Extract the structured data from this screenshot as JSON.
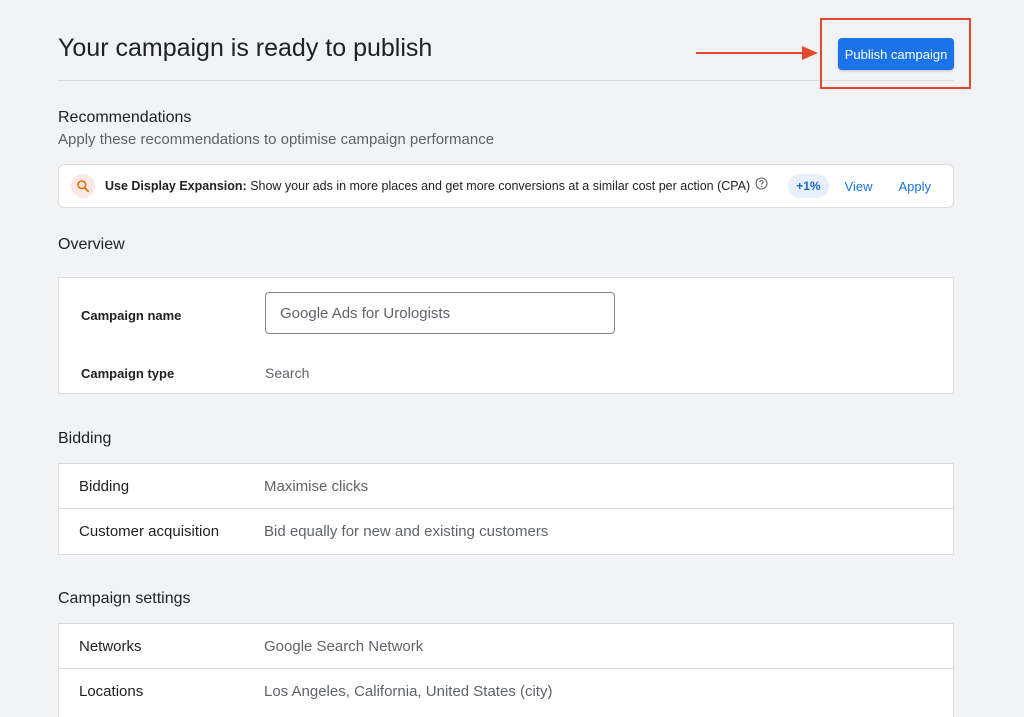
{
  "page": {
    "title": "Your campaign is ready to publish",
    "publish_label": "Publish campaign"
  },
  "recommendations": {
    "heading": "Recommendations",
    "subtitle": "Apply these recommendations to optimise campaign performance",
    "item": {
      "icon": "search-icon",
      "title": "Use Display Expansion:",
      "description": " Show your ads in more places and get more conversions at a similar cost per action (CPA)",
      "uplift": "+1%",
      "view_label": "View",
      "apply_label": "Apply"
    }
  },
  "overview": {
    "heading": "Overview",
    "campaign_name_label": "Campaign name",
    "campaign_name_value": "Google Ads for Urologists",
    "campaign_type_label": "Campaign type",
    "campaign_type_value": "Search"
  },
  "bidding": {
    "heading": "Bidding",
    "rows": [
      {
        "label": "Bidding",
        "value": "Maximise clicks"
      },
      {
        "label": "Customer acquisition",
        "value": "Bid equally for new and existing customers"
      }
    ]
  },
  "campaign_settings": {
    "heading": "Campaign settings",
    "rows": [
      {
        "label": "Networks",
        "value": "Google Search Network"
      },
      {
        "label": "Locations",
        "value": "Los Angeles, California, United States (city)"
      }
    ]
  },
  "colors": {
    "primary": "#1a73e8",
    "annotation": "#e2492f",
    "background": "#f1f3f4"
  }
}
